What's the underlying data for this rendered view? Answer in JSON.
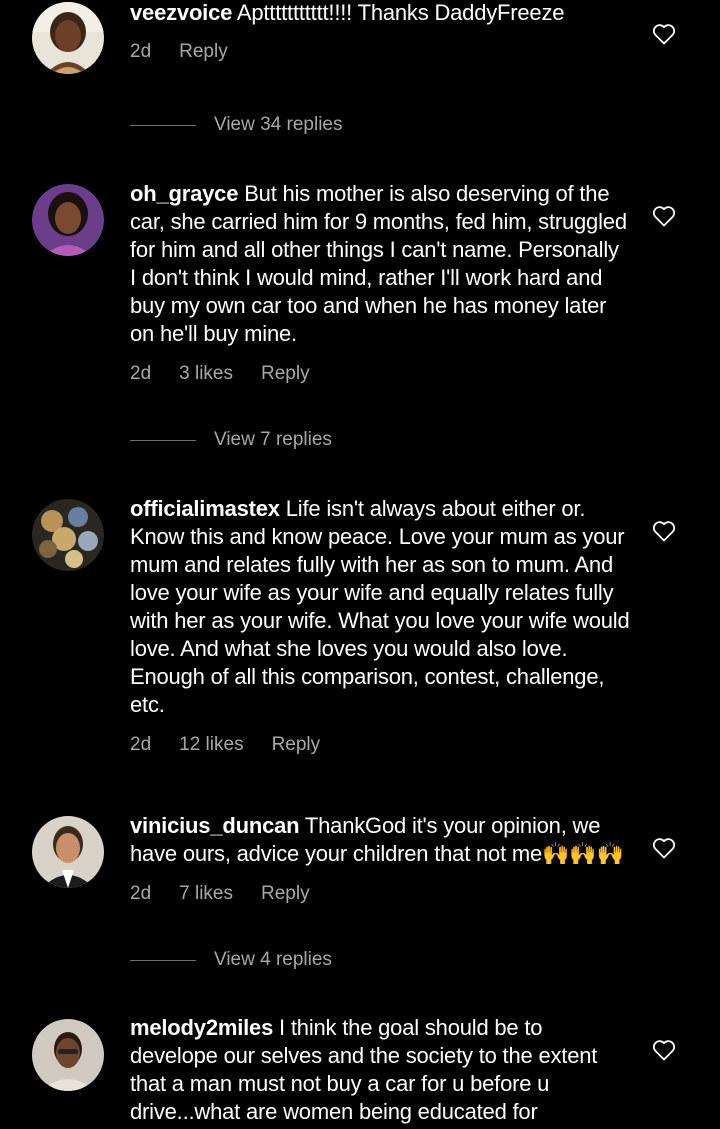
{
  "comments": [
    {
      "username": "veezvoice",
      "text": "Apttttttttttt!!!! Thanks DaddyFreeze",
      "time": "2d",
      "likes": "",
      "reply": "Reply",
      "view_replies": "View 34 replies"
    },
    {
      "username": "oh_grayce",
      "text": "But his mother is also deserving of the car, she carried him for 9 months, fed him, struggled for him and all other things I can't name. Personally I don't think I would mind, rather I'll work hard and buy my own car too and when he has money later on he'll buy mine.",
      "time": "2d",
      "likes": "3 likes",
      "reply": "Reply",
      "view_replies": "View 7 replies"
    },
    {
      "username": "officialimastex",
      "text": "Life isn't always about either or. Know this and know peace. Love your mum as your mum and relates fully with her as son to mum. And love your wife as your wife and equally relates fully with her as your wife. What you love your wife would love. And what she loves you would also love. Enough of all this comparison, contest, challenge, etc.",
      "time": "2d",
      "likes": "12 likes",
      "reply": "Reply"
    },
    {
      "username": "vinicius_duncan",
      "text": "ThankGod it's your opinion, we have ours, advice your children that not me🙌🙌🙌",
      "time": "2d",
      "likes": "7 likes",
      "reply": "Reply",
      "view_replies": "View 4 replies"
    },
    {
      "username": "melody2miles",
      "text": "I think the goal should be to develope our selves and the society to the extent that a man must not buy a car for u before u drive...what are women being educated for"
    }
  ],
  "icons": {
    "like": "heart-outline-icon"
  },
  "colors": {
    "background": "#000000",
    "text": "#ffffff",
    "secondary": "#a8a8a8"
  }
}
